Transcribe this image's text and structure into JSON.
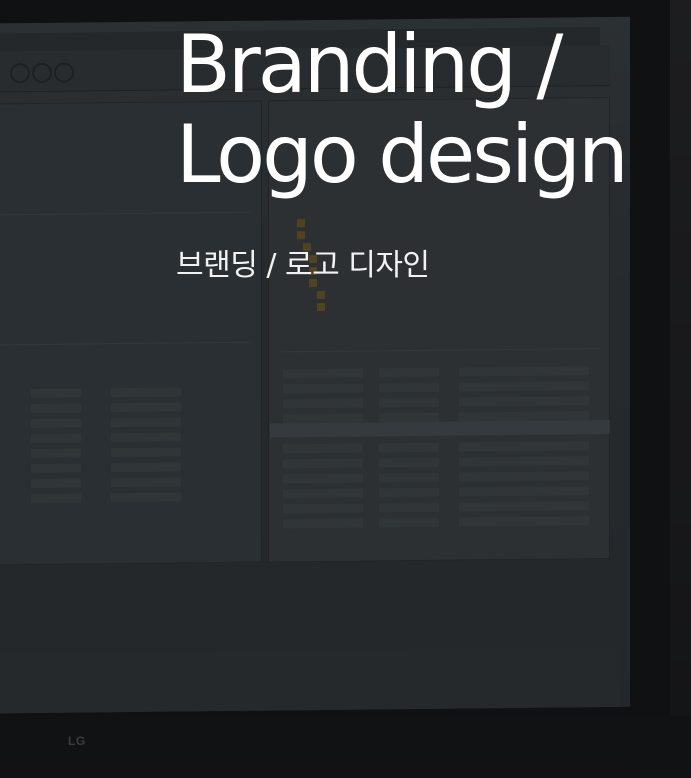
{
  "hero": {
    "title_line1": "Branding /",
    "title_line2": "Logo design",
    "subtitle": "브랜딩 / 로고 디자인"
  },
  "background": {
    "monitor_brand": "LG"
  },
  "colors": {
    "overlay": "#121214",
    "text": "#ffffff"
  }
}
